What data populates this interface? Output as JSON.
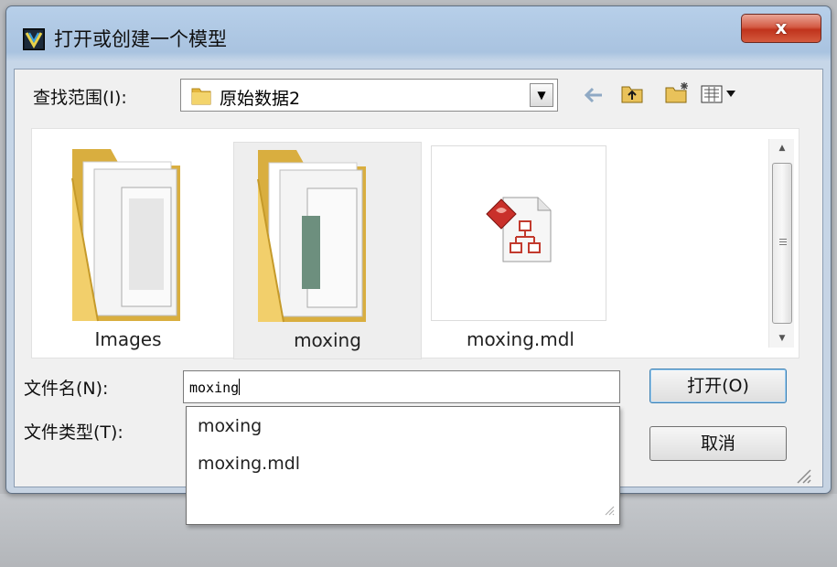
{
  "window": {
    "title": "打开或创建一个模型",
    "close_glyph": "x"
  },
  "toolbar": {
    "look_in_label": "查找范围(I):",
    "look_in_value": "原始数据2"
  },
  "files": [
    {
      "label": "Images",
      "icon": "folder-icon"
    },
    {
      "label": "moxing",
      "icon": "folder-icon"
    },
    {
      "label": "moxing.mdl",
      "icon": "mdl-file-icon"
    }
  ],
  "form": {
    "filename_label": "文件名(N):",
    "filename_value": "moxing",
    "filetype_label": "文件类型(T):"
  },
  "buttons": {
    "open": "打开(O)",
    "cancel": "取消"
  },
  "autocomplete": [
    "moxing",
    "moxing.mdl"
  ],
  "colors": {
    "title_bar": "#a9c3e0",
    "close_button": "#c0331c",
    "folder": "#e7c95c"
  }
}
